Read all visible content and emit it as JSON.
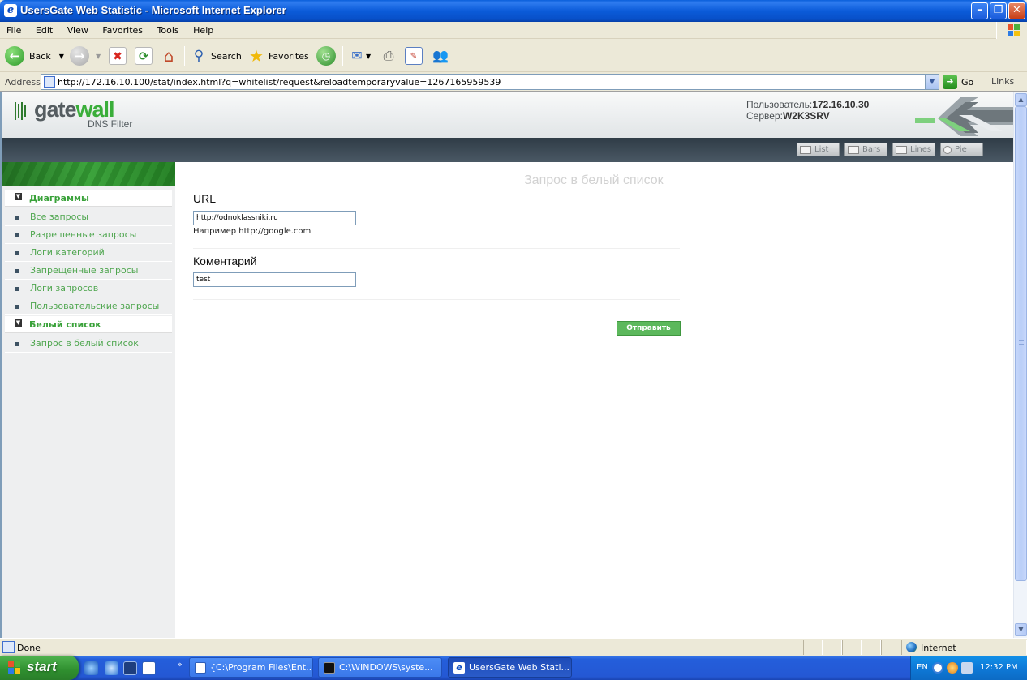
{
  "window": {
    "title": "UsersGate Web Statistic - Microsoft Internet Explorer"
  },
  "menu": {
    "items": [
      "File",
      "Edit",
      "View",
      "Favorites",
      "Tools",
      "Help"
    ]
  },
  "toolbar": {
    "back_label": "Back",
    "search_label": "Search",
    "favorites_label": "Favorites"
  },
  "address": {
    "label": "Address",
    "url": "http://172.16.10.100/stat/index.html?q=whitelist/request&reloadtemporaryvalue=1267165959539",
    "go_label": "Go",
    "links_label": "Links"
  },
  "site": {
    "logo_main": "gate",
    "logo_accent": "wall",
    "logo_sub": "DNS Filter",
    "user_label": "Пользователь:",
    "user_value": "172.16.10.30",
    "server_label": "Сервер:",
    "server_value": "W2K3SRV",
    "views": [
      "List",
      "Bars",
      "Lines",
      "Pie"
    ]
  },
  "sidebar": {
    "section_charts": "Диаграммы",
    "chart_items": [
      "Все запросы",
      "Разрешенные запросы",
      "Логи категорий",
      "Запрещенные запросы",
      "Логи запросов",
      "Пользовательские запросы"
    ],
    "section_whitelist": "Белый список",
    "whitelist_items": [
      "Запрос в белый список"
    ]
  },
  "form": {
    "heading": "Запрос в белый список",
    "url_label": "URL",
    "url_value": "http://odnoklassniki.ru",
    "url_hint": "Например http://google.com",
    "comment_label": "Коментарий",
    "comment_value": "test",
    "submit_label": "Отправить"
  },
  "status": {
    "text": "Done",
    "zone": "Internet"
  },
  "taskbar": {
    "start_label": "start",
    "tasks": [
      "{C:\\Program Files\\Ent...",
      "C:\\WINDOWS\\syste...",
      "UsersGate Web Stati..."
    ],
    "lang": "EN",
    "clock": "12:32 PM"
  },
  "colors": {
    "accent_green": "#3AA23A",
    "titlebar_blue": "#0B5BD9",
    "nav_dark": "#2F3C46"
  }
}
